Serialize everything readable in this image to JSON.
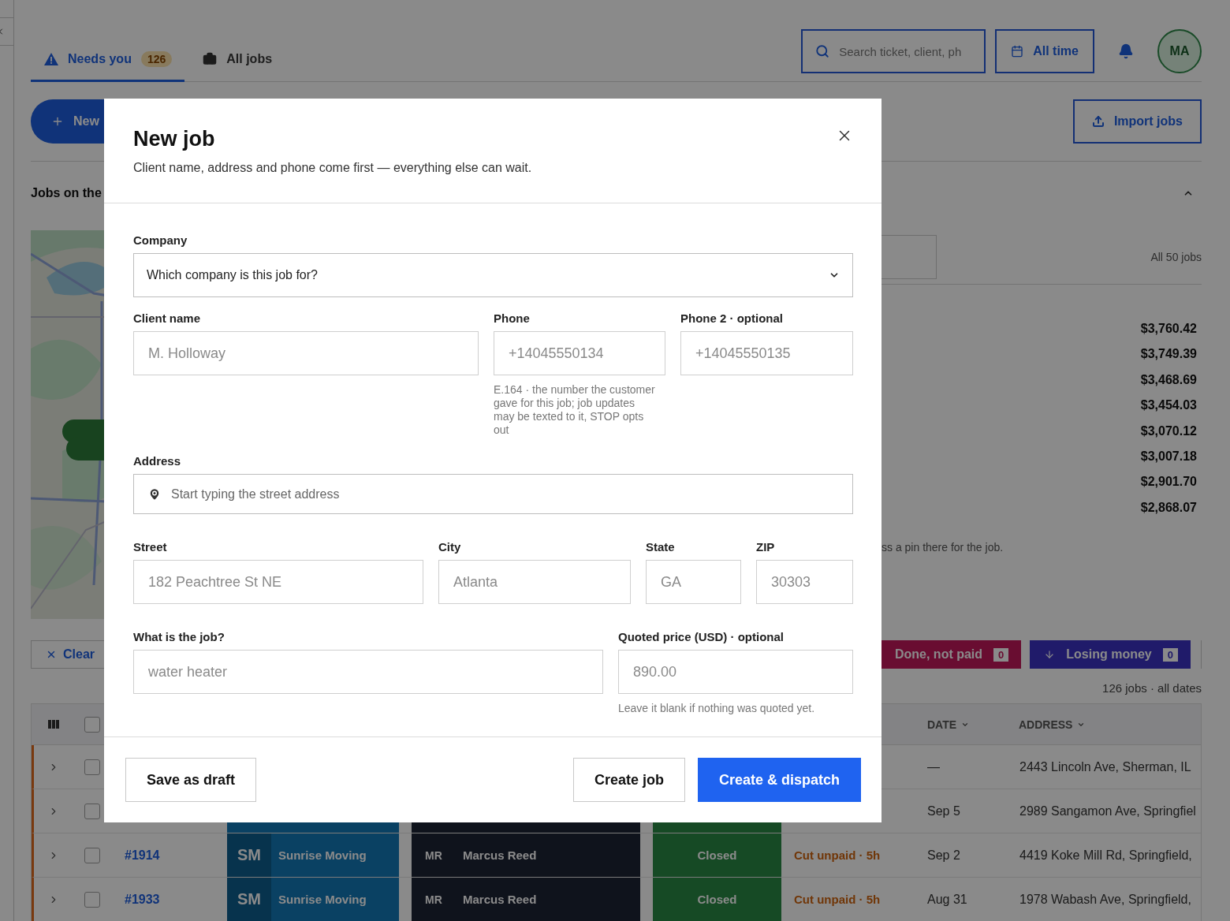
{
  "tabs": [
    {
      "label": "Needs you",
      "count": "126",
      "selected": true
    },
    {
      "label": "All jobs",
      "selected": false
    }
  ],
  "search": {
    "placeholder": "Search ticket, client, ph"
  },
  "date_filter": {
    "label": "All time"
  },
  "user": {
    "initials": "MA"
  },
  "new_button": {
    "label": "New"
  },
  "import_button": {
    "label": "Import jobs"
  },
  "map_section": {
    "title": "Jobs on the",
    "expanded": true
  },
  "jobs_panel": {
    "count_label": "All 50 jobs",
    "amounts": [
      "$3,760.42",
      "$3,749.39",
      "$3,468.69",
      "$3,454.03",
      "$3,070.12",
      "$3,007.18",
      "$2,901.70",
      "$2,868.07"
    ],
    "hint": "ss a pin there for the job."
  },
  "clear_button": {
    "label": "Clear"
  },
  "filters": [
    {
      "label": "Done, not paid",
      "count": "0"
    },
    {
      "label": "Losing money",
      "count": "0"
    }
  ],
  "summary": "126 jobs · all dates",
  "table": {
    "select_all": {
      "checked": false
    },
    "columns": [
      {
        "label": "DATE"
      },
      {
        "label": "ADDRESS"
      }
    ],
    "rows": [
      {
        "flagged": true,
        "expanded": false,
        "checked": false,
        "date": "—",
        "address": "2443 Lincoln Ave, Sherman, IL"
      },
      {
        "flagged": true,
        "expanded": false,
        "checked": false,
        "date": "Sep 5",
        "address": "2989 Sangamon Ave, Springfiel"
      },
      {
        "flagged": true,
        "expanded": false,
        "checked": false,
        "job": "#1914",
        "company_initials": "SM",
        "company": "Sunrise Moving",
        "tech_initials": "MR",
        "technician": "Marcus Reed",
        "status": "Closed",
        "alert": "Cut unpaid · 5h",
        "date": "Sep 2",
        "address": "4419 Koke Mill Rd, Springfield,"
      },
      {
        "flagged": true,
        "expanded": false,
        "checked": false,
        "job": "#1933",
        "company_initials": "SM",
        "company": "Sunrise Moving",
        "tech_initials": "MR",
        "technician": "Marcus Reed",
        "status": "Closed",
        "alert": "Cut unpaid · 5h",
        "date": "Aug 31",
        "address": "1978 Wabash Ave, Springfield,"
      }
    ]
  },
  "modal": {
    "title": "New job",
    "subtitle": "Client name, address and phone come first — everything else can wait.",
    "sections": [
      {
        "fields": [
          {
            "kind": "select",
            "label": "Company",
            "prompt": "Which company is this job for?"
          }
        ]
      },
      {
        "fields": [
          {
            "kind": "text",
            "label": "Client name",
            "placeholder": "M. Holloway"
          },
          {
            "kind": "text",
            "label": "Phone",
            "placeholder": "+14045550134",
            "hint": "E.164 · the number the customer gave for this job; job updates may be texted to it, STOP opts out"
          },
          {
            "kind": "text",
            "label": "Phone 2 · optional",
            "placeholder": "+14045550135"
          }
        ]
      },
      {
        "fields": [
          {
            "kind": "address",
            "label": "Address",
            "placeholder": "Start typing the street address"
          }
        ]
      },
      {
        "fields": [
          {
            "kind": "text",
            "label": "Street",
            "placeholder": "182 Peachtree St NE"
          },
          {
            "kind": "text",
            "label": "City",
            "placeholder": "Atlanta"
          },
          {
            "kind": "text",
            "label": "State",
            "placeholder": "GA"
          },
          {
            "kind": "text",
            "label": "ZIP",
            "placeholder": "30303"
          }
        ]
      },
      {
        "fields": [
          {
            "kind": "text",
            "label": "What is the job?",
            "placeholder": "water heater"
          },
          {
            "kind": "text",
            "label": "Quoted price (USD) · optional",
            "placeholder": "890.00",
            "hint": "Leave it blank if nothing was quoted yet."
          }
        ]
      }
    ],
    "buttons": [
      {
        "label": "Save as draft",
        "kind": "draft"
      },
      {
        "label": "Create job",
        "kind": "secondary"
      },
      {
        "label": "Create & dispatch",
        "kind": "primary"
      }
    ]
  }
}
